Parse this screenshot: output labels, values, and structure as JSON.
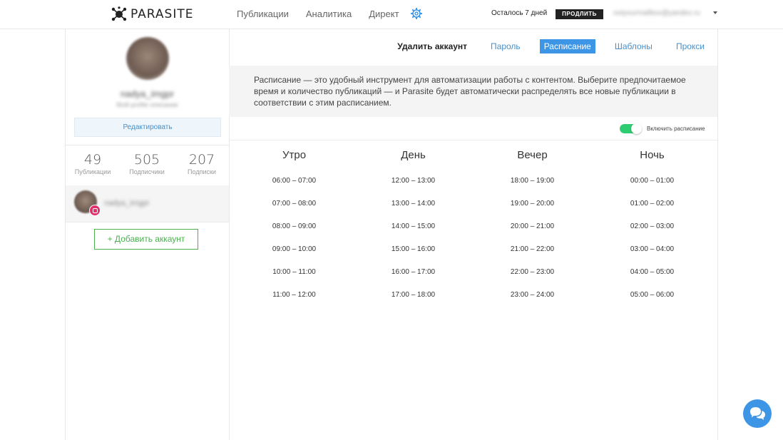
{
  "header": {
    "logo_text": "PARASITE",
    "nav": [
      "Публикации",
      "Аналитика",
      "Директ"
    ],
    "remaining": "Осталось 7 дней",
    "extend_label": "ПРОДЛИТЬ",
    "email": "notyourmailbox@yandex.ru"
  },
  "sidebar": {
    "user_name": "nadya_imgpr",
    "user_sub": "Мой profile описание",
    "edit_label": "Редактировать",
    "stats": [
      {
        "num": "49",
        "label": "Публикации"
      },
      {
        "num": "505",
        "label": "Подписчики"
      },
      {
        "num": "207",
        "label": "Подписки"
      }
    ],
    "account_name": "nadya_imgpr",
    "add_account_label": "+ Добавить аккаунт"
  },
  "tabs": {
    "delete": "Удалить аккаунт",
    "password": "Пароль",
    "schedule": "Расписание",
    "templates": "Шаблоны",
    "proxy": "Прокси"
  },
  "info_text": "Расписание — это удобный инструмент для автоматизации работы с контентом. Выберите предпочитаемое время и количество публикаций — и Parasite будет автоматически распределять все новые публикации в соответствии с этим расписанием.",
  "toggle": {
    "label": "Включить расписание",
    "enabled": true,
    "color": "#2ecc71"
  },
  "schedule": [
    {
      "title": "Утро",
      "slots": [
        "06:00 – 07:00",
        "07:00 – 08:00",
        "08:00 – 09:00",
        "09:00 – 10:00",
        "10:00 – 11:00",
        "11:00 – 12:00"
      ]
    },
    {
      "title": "День",
      "slots": [
        "12:00 – 13:00",
        "13:00 – 14:00",
        "14:00 – 15:00",
        "15:00 – 16:00",
        "16:00 – 17:00",
        "17:00 – 18:00"
      ]
    },
    {
      "title": "Вечер",
      "slots": [
        "18:00 – 19:00",
        "19:00 – 20:00",
        "20:00 – 21:00",
        "21:00 – 22:00",
        "22:00 – 23:00",
        "23:00 – 24:00"
      ]
    },
    {
      "title": "Ночь",
      "slots": [
        "00:00 – 01:00",
        "01:00 – 02:00",
        "02:00 – 03:00",
        "03:00 – 04:00",
        "04:00 – 05:00",
        "05:00 – 06:00"
      ]
    }
  ],
  "colors": {
    "accent": "#3d95e6",
    "add_button": "#4caf50"
  }
}
